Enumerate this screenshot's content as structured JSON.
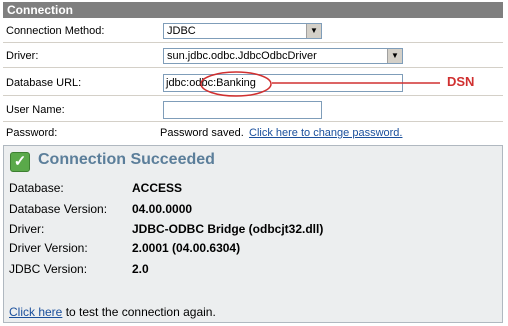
{
  "section_title": "Connection",
  "fields": {
    "connection_method": {
      "label": "Connection Method:",
      "value": "JDBC"
    },
    "driver": {
      "label": "Driver:",
      "value": "sun.jdbc.odbc.JdbcOdbcDriver"
    },
    "database_url": {
      "label": "Database URL:",
      "value": "jdbc:odbc:Banking"
    },
    "user_name": {
      "label": "User Name:",
      "value": ""
    },
    "password": {
      "label": "Password:",
      "status": "Password saved.",
      "change_link": "Click here to change password."
    }
  },
  "annotation": {
    "label": "DSN",
    "color": "#d03030"
  },
  "result": {
    "title": "Connection Succeeded",
    "rows": [
      {
        "label": "Database:",
        "value": "ACCESS"
      },
      {
        "label": "Database Version:",
        "value": "04.00.0000"
      },
      {
        "label": "Driver:",
        "value": "JDBC-ODBC Bridge (odbcjt32.dll)"
      },
      {
        "label": "Driver Version:",
        "value": "2.0001 (04.00.6304)"
      },
      {
        "label": "JDBC Version:",
        "value": "2.0"
      }
    ],
    "retest_link": "Click here",
    "retest_text": " to test the connection again."
  },
  "colors": {
    "header": "#7f7f7f",
    "success": "#5aa94a",
    "link": "#1a4f9c"
  }
}
